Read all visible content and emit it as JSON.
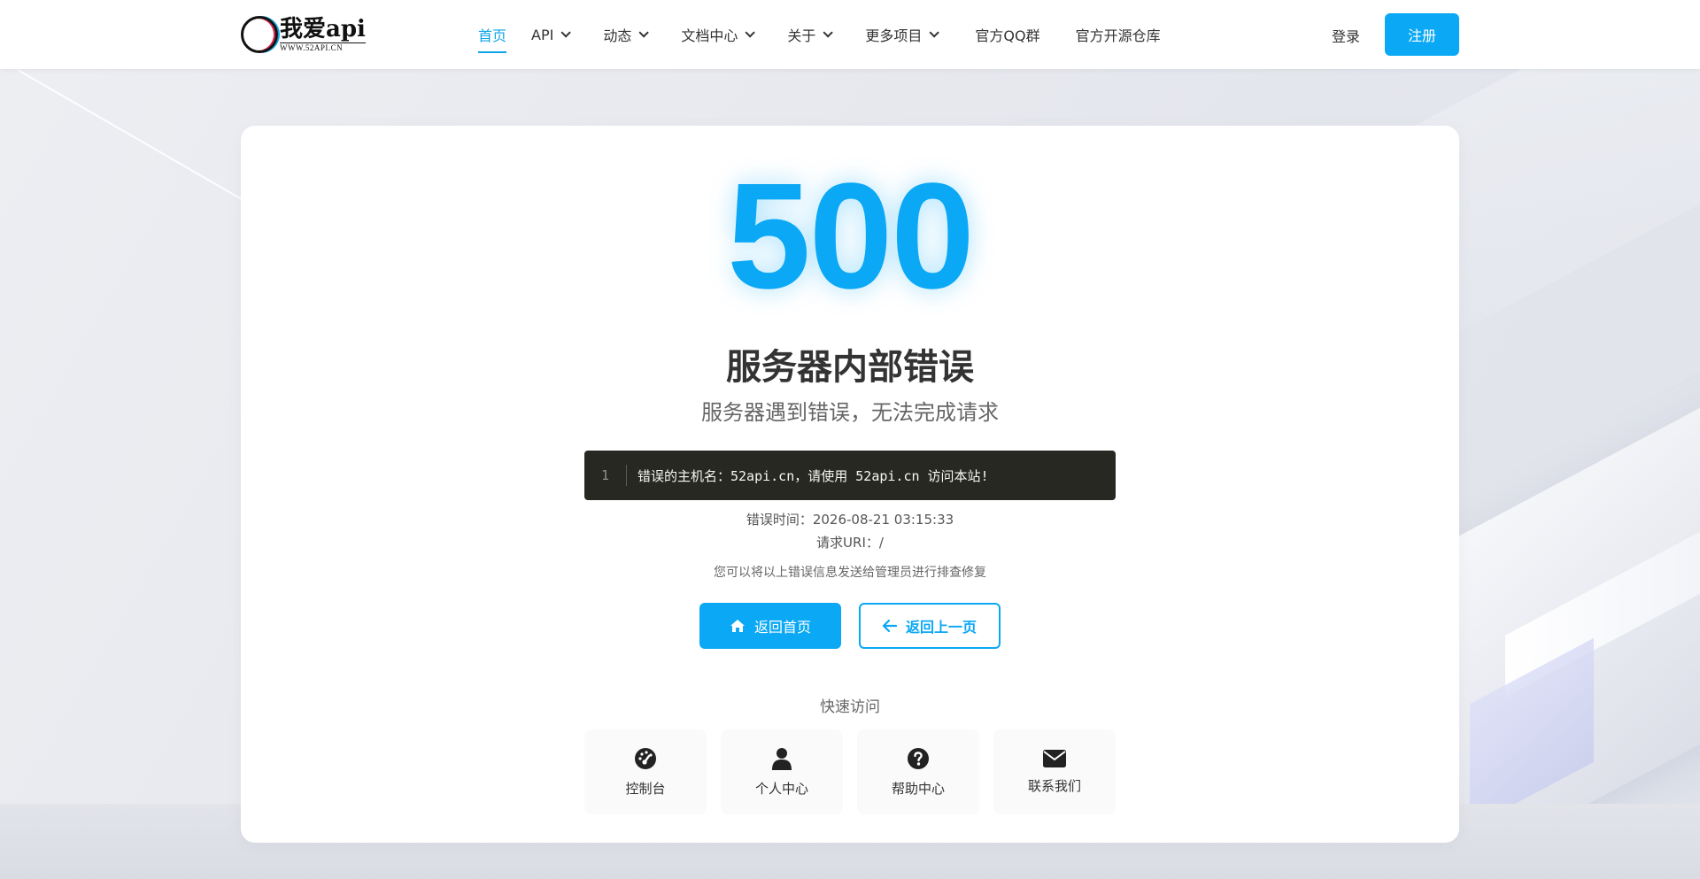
{
  "header": {
    "logo": {
      "main": "我爱api",
      "sub": "WWW.52API.CN"
    },
    "nav": [
      {
        "label": "首页",
        "active": true,
        "dropdown": false
      },
      {
        "label": "API",
        "active": false,
        "dropdown": true
      },
      {
        "label": "动态",
        "active": false,
        "dropdown": true
      },
      {
        "label": "文档中心",
        "active": false,
        "dropdown": true
      },
      {
        "label": "关于",
        "active": false,
        "dropdown": true
      },
      {
        "label": "更多项目",
        "active": false,
        "dropdown": true
      },
      {
        "label": "官方QQ群",
        "active": false,
        "dropdown": false
      },
      {
        "label": "官方开源仓库",
        "active": false,
        "dropdown": false
      }
    ],
    "login_label": "登录",
    "register_label": "注册"
  },
  "error": {
    "code": "500",
    "title": "服务器内部错误",
    "subtitle": "服务器遇到错误，无法完成请求",
    "code_line_number": "1",
    "code_line_text": "错误的主机名：52api.cn，请使用 52api.cn 访问本站!",
    "time_line": "错误时间：2026-08-21 03:15:33",
    "uri_line": "请求URI：/",
    "hint": "您可以将以上错误信息发送给管理员进行排查修复"
  },
  "actions": {
    "home_label": "返回首页",
    "back_label": "返回上一页"
  },
  "quick": {
    "title": "快速访问",
    "items": [
      {
        "label": "控制台",
        "icon": "dashboard-icon"
      },
      {
        "label": "个人中心",
        "icon": "user-icon"
      },
      {
        "label": "帮助中心",
        "icon": "question-circle-icon"
      },
      {
        "label": "联系我们",
        "icon": "envelope-icon"
      }
    ]
  },
  "colors": {
    "accent": "#0aa8f5",
    "code_bg": "#272822",
    "text": "#333333"
  }
}
